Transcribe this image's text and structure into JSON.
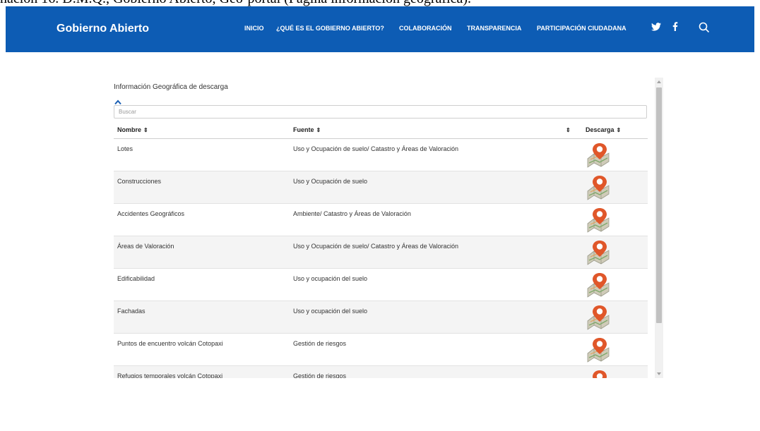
{
  "caption": "nación 16. D.M.Q., Gobierno Abierto, Geo-portal (Página información geográfica).",
  "header": {
    "brand": "Gobierno Abierto",
    "nav": [
      "INICIO",
      "¿QUÉ ES EL GOBIERNO ABIERTO?",
      "COLABORACIÓN",
      "TRANSPARENCIA",
      "PARTICIPACIÓN CIUDADANA"
    ],
    "social_icons": [
      "twitter-icon",
      "facebook-icon"
    ],
    "search_icon": "search-icon",
    "background": "#0d5cb4"
  },
  "panel": {
    "title": "Información Geográfica de descarga",
    "search_placeholder": "Buscar",
    "columns": {
      "nombre": "Nombre",
      "fuente": "Fuente",
      "descarga": "Descarga",
      "sort_glyph": "⇕"
    },
    "rows": [
      {
        "nombre": "Lotes",
        "fuente": "Uso y Ocupación de suelo/ Catastro y Áreas de Valoración"
      },
      {
        "nombre": "Construcciones",
        "fuente": "Uso y Ocupación de suelo"
      },
      {
        "nombre": "Accidentes Geográficos",
        "fuente": "Ambiente/ Catastro y Áreas de Valoración"
      },
      {
        "nombre": "Áreas de Valoración",
        "fuente": "Uso y Ocupación de suelo/ Catastro y Áreas de Valoración"
      },
      {
        "nombre": "Edificabilidad",
        "fuente": "Uso y ocupación del suelo"
      },
      {
        "nombre": "Fachadas",
        "fuente": "Uso y ocupación del suelo"
      },
      {
        "nombre": "Puntos de encuentro volcán Cotopaxi",
        "fuente": "Gestión de riesgos"
      },
      {
        "nombre": "Refugios temporales volcán Cotopaxi",
        "fuente": "Gestión de riesgos"
      }
    ],
    "download_icon": "map-download-icon"
  }
}
